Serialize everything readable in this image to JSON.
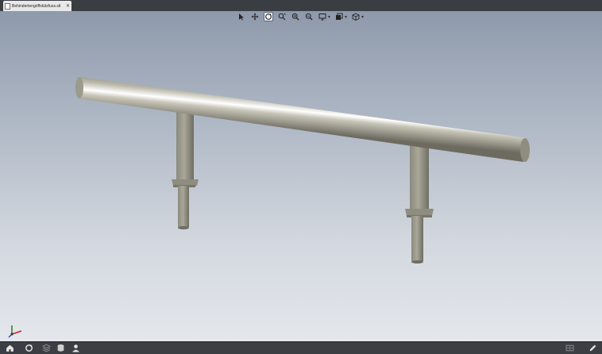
{
  "document_tab": {
    "title": "Behindertengriffstützfuss.stl",
    "close_glyph": "✕"
  },
  "navigation_toolbar": {
    "tools": [
      {
        "name": "select-icon",
        "active": false
      },
      {
        "name": "pan-icon",
        "active": false
      },
      {
        "name": "rotate-icon",
        "active": true
      },
      {
        "name": "look-at-icon",
        "active": false
      },
      {
        "name": "zoom-window-icon",
        "active": false
      },
      {
        "name": "zoom-icon",
        "active": false
      },
      {
        "name": "display-mode-icon",
        "active": false,
        "has_dropdown": true
      },
      {
        "name": "visual-style-icon",
        "active": false,
        "has_dropdown": true
      },
      {
        "name": "view-cube-icon",
        "active": false,
        "has_dropdown": true
      }
    ],
    "caret_glyph": "▾"
  },
  "statusbar": {
    "left_buttons": [
      "home-icon",
      "sync-icon",
      "layers-icon",
      "database-icon",
      "user-icon"
    ],
    "right_buttons": [
      "grid-icon",
      "pencil-icon"
    ]
  },
  "colors": {
    "viewport_top": "#8e99ab",
    "viewport_bottom": "#e4e7ec",
    "metal": "#b5b2a3",
    "chrome_bar": "#3b3e43"
  }
}
